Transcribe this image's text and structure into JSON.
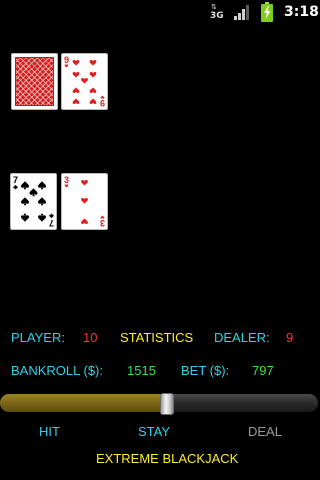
{
  "status_bar": {
    "network_type": "3G",
    "network_icon": "3g-data-icon",
    "signal_icon": "signal-strength-icon",
    "battery_icon": "battery-charging-icon",
    "time": "3:18"
  },
  "table": {
    "dealer_cards": [
      {
        "face": "down",
        "icon": "card-back-icon"
      },
      {
        "face": "up",
        "rank": "9",
        "suit": "hearts",
        "color": "#e02020"
      }
    ],
    "player_cards": [
      {
        "face": "up",
        "rank": "7",
        "suit": "spades",
        "color": "#000000"
      },
      {
        "face": "up",
        "rank": "3",
        "suit": "hearts",
        "color": "#e02020"
      }
    ]
  },
  "scores": {
    "player_label": "PLAYER:",
    "player_value": "10",
    "statistics_label": "STATISTICS",
    "dealer_label": "DEALER:",
    "dealer_value": "9"
  },
  "money": {
    "bankroll_label": "BANKROLL ($):",
    "bankroll_value": "1515",
    "bet_label": "BET ($):",
    "bet_value": "797"
  },
  "bet_slider": {
    "fraction": 0.526
  },
  "actions": {
    "hit_label": "HIT",
    "stay_label": "STAY",
    "deal_label": "DEAL",
    "deal_enabled": false
  },
  "footer": {
    "title": "EXTREME BLACKJACK"
  },
  "colors": {
    "background": "#000000",
    "label_cyan": "#33cfe8",
    "accent_yellow": "#ffee22",
    "value_red": "#ff3030",
    "value_green": "#33e34a",
    "disabled_gray": "#9a9a9a",
    "slider_fill": "#7c6616"
  }
}
